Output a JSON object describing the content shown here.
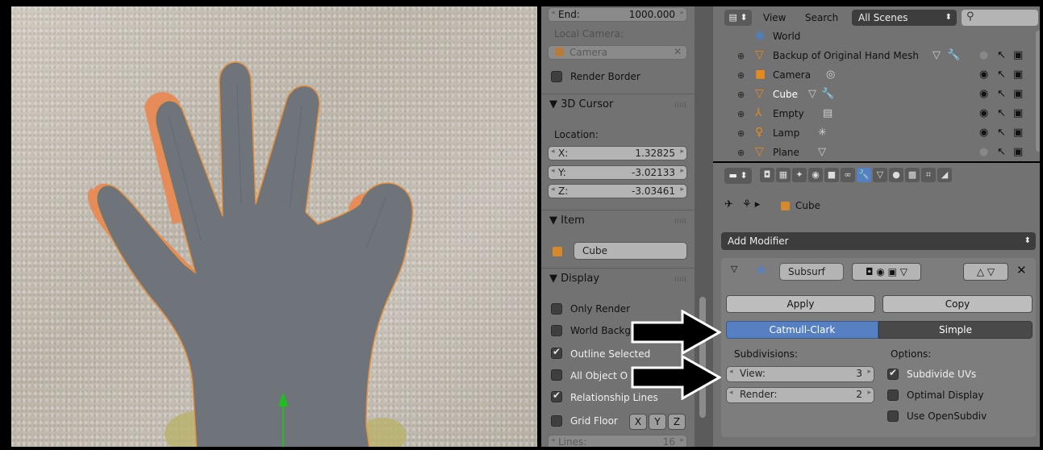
{
  "npanel": {
    "end_label": "End:",
    "end_value": "1000.000",
    "local_camera_label": "Local Camera:",
    "camera_field": "Camera",
    "render_border": "Render Border",
    "cursor_title": "3D Cursor",
    "location_label": "Location:",
    "cursor": [
      {
        "label": "X:",
        "value": "1.32825"
      },
      {
        "label": "Y:",
        "value": "-3.02133"
      },
      {
        "label": "Z:",
        "value": "-3.03461"
      }
    ],
    "item_title": "Item",
    "item_name": "Cube",
    "display_title": "Display",
    "display_options": [
      {
        "label": "Only Render",
        "checked": false
      },
      {
        "label": "World Backg",
        "checked": false
      },
      {
        "label": "Outline Selected",
        "checked": true
      },
      {
        "label": "All Object O",
        "checked": false
      },
      {
        "label": "Relationship Lines",
        "checked": true
      },
      {
        "label": "Grid Floor",
        "checked": false
      }
    ],
    "axes": [
      "X",
      "Y",
      "Z"
    ],
    "lines_label": "Lines:",
    "lines_value": "16"
  },
  "outliner": {
    "menu_view": "View",
    "menu_search": "Search",
    "scene_filter": "All Scenes",
    "items": [
      {
        "name": "World",
        "icon": "world-icon",
        "has_eye": false
      },
      {
        "name": "Backup of Original Hand Mesh",
        "icon": "mesh-icon",
        "has_eye": true
      },
      {
        "name": "Camera",
        "icon": "camera-icon",
        "has_eye": true
      },
      {
        "name": "Cube",
        "icon": "mesh-icon",
        "has_eye": true
      },
      {
        "name": "Empty",
        "icon": "empty-icon",
        "has_eye": true
      },
      {
        "name": "Lamp",
        "icon": "lamp-icon",
        "has_eye": true
      },
      {
        "name": "Plane",
        "icon": "mesh-icon",
        "has_eye": true
      }
    ]
  },
  "properties": {
    "breadcrumb_object": "Cube",
    "add_modifier": "Add Modifier",
    "modifier_name": "Subsurf",
    "apply": "Apply",
    "copy": "Copy",
    "mode_catmull": "Catmull-Clark",
    "mode_simple": "Simple",
    "subdivisions_label": "Subdivisions:",
    "options_label": "Options:",
    "view_label": "View:",
    "view_value": "3",
    "render_label": "Render:",
    "render_value": "2",
    "options": [
      {
        "label": "Subdivide UVs",
        "checked": true
      },
      {
        "label": "Optimal Display",
        "checked": false
      },
      {
        "label": "Use OpenSubdiv",
        "checked": false
      }
    ]
  },
  "colors": {
    "panel_bg": "#727272",
    "accent_blue": "#5680c2",
    "mesh_grey": "#6f747b",
    "selection_outline": "#e7903d"
  }
}
